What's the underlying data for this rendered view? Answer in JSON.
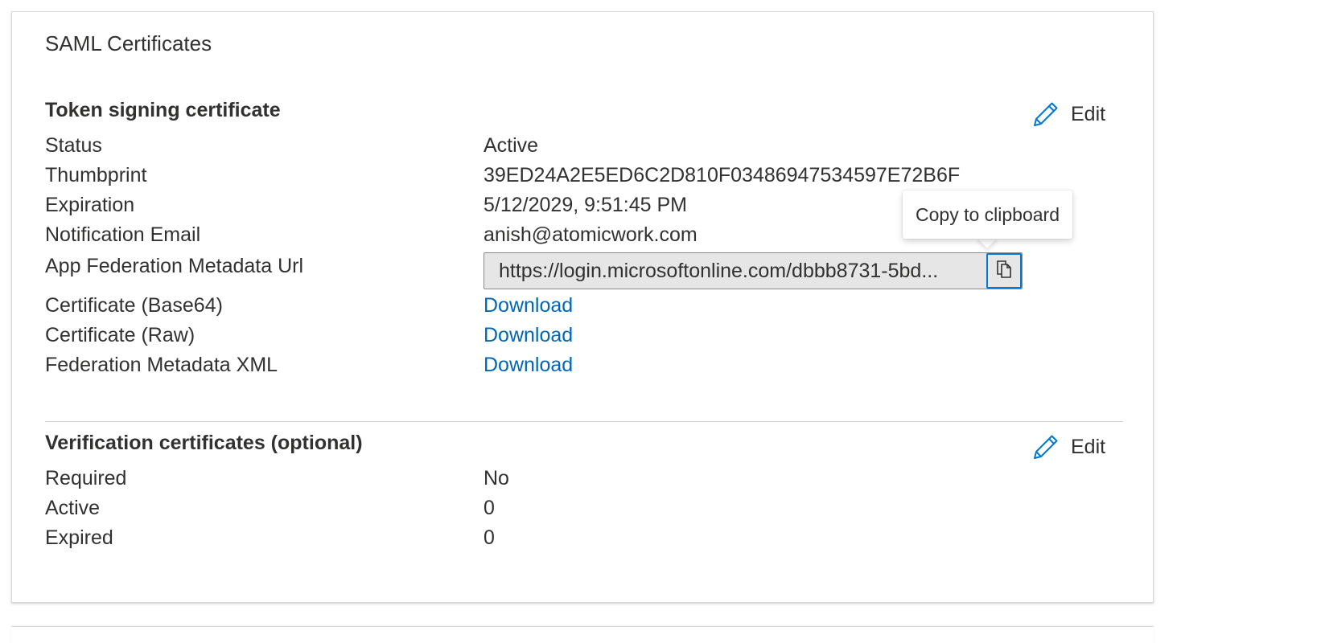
{
  "card": {
    "title": "SAML Certificates"
  },
  "token_signing": {
    "title": "Token signing certificate",
    "edit_label": "Edit",
    "rows": [
      {
        "label": "Status",
        "value": "Active"
      },
      {
        "label": "Thumbprint",
        "value": "39ED24A2E5ED6C2D810F03486947534597E72B6F"
      },
      {
        "label": "Expiration",
        "value": "5/12/2029, 9:51:45 PM"
      },
      {
        "label": "Notification Email",
        "value": "anish@atomicwork.com"
      },
      {
        "label": "App Federation Metadata Url",
        "value": "https://login.microsoftonline.com/dbbb8731-5bd..."
      },
      {
        "label": "Certificate (Base64)",
        "value": "Download"
      },
      {
        "label": "Certificate (Raw)",
        "value": "Download"
      },
      {
        "label": "Federation Metadata XML",
        "value": "Download"
      }
    ],
    "copy_tooltip": "Copy to clipboard",
    "copy_icon": "copy-icon",
    "edit_icon": "pencil-icon"
  },
  "verification": {
    "title": "Verification certificates (optional)",
    "edit_label": "Edit",
    "rows": [
      {
        "label": "Required",
        "value": "No"
      },
      {
        "label": "Active",
        "value": "0"
      },
      {
        "label": "Expired",
        "value": "0"
      }
    ]
  },
  "colors": {
    "link": "#0067b8",
    "accent": "#0078d4",
    "text": "#323130",
    "input_bg": "#e6e6e6"
  }
}
